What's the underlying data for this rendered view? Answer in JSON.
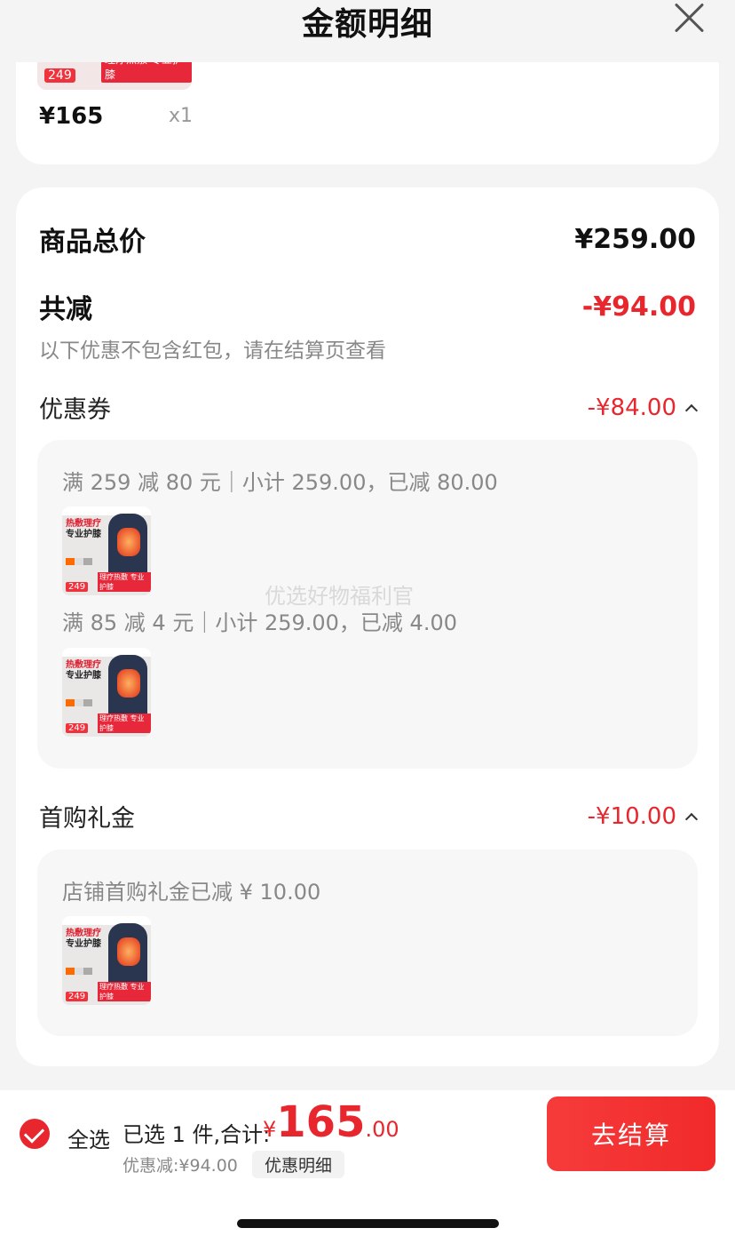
{
  "header": {
    "title": "金额明细"
  },
  "item": {
    "thumb_price": "249",
    "thumb_tag": "理疗热敷 专业护膝",
    "price": "¥165",
    "qty": "x1"
  },
  "summary": {
    "total_label": "商品总价",
    "total_value": "¥259.00",
    "reduce_label": "共减",
    "reduce_value": "-¥94.00",
    "note": "以下优惠不包含红包，请在结算页查看"
  },
  "coupon": {
    "label": "优惠券",
    "value": "-¥84.00",
    "lines": [
      "满 259 减 80 元｜小计 259.00，已减 80.00",
      "满 85 减 4 元｜小计 259.00，已减 4.00"
    ]
  },
  "first_gift": {
    "label": "首购礼金",
    "value": "-¥10.00",
    "line": "店铺首购礼金已减 ¥ 10.00"
  },
  "product_thumb": {
    "title1": "热敷理疗",
    "title2": "专业护膝",
    "price": "249",
    "tag": "理疗热敷 专业护膝"
  },
  "watermark": "优选好物福利官",
  "bottom": {
    "select_all": "全选",
    "selected_text": "已选 1 件,合计:",
    "currency": "¥",
    "total_int": "165",
    "total_dec": ".00",
    "discount": "优惠减:¥94.00",
    "detail_button": "优惠明细",
    "checkout_button": "去结算"
  }
}
